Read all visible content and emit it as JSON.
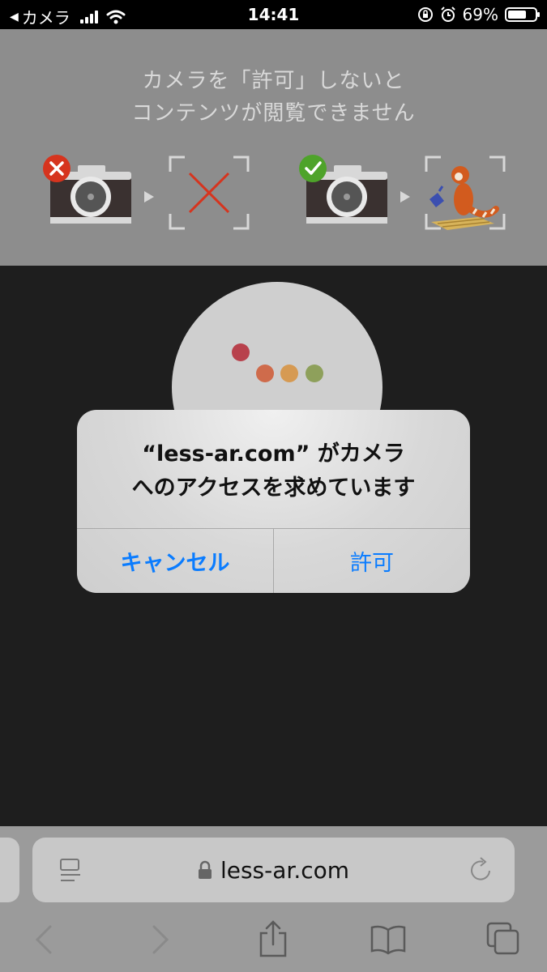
{
  "status_bar": {
    "back_app": "カメラ",
    "time": "14:41",
    "battery": "69%",
    "battery_level": 0.69
  },
  "banner": {
    "line1": "カメラを「許可」しないと",
    "line2": "コンテンツが閲覧できません"
  },
  "alert": {
    "line1": "“less-ar.com” がカメラ",
    "line2": "へのアクセスを求めています",
    "cancel_label": "キャンセル",
    "allow_label": "許可"
  },
  "browser": {
    "url": "less-ar.com"
  },
  "colors": {
    "accent": "#0a7cff",
    "dot1": "#b8414c",
    "dot2": "#cf6b4b",
    "dot3": "#d69a52",
    "dot4": "#8ea05b",
    "denied": "#d6341e",
    "allowed": "#4ea32a"
  }
}
